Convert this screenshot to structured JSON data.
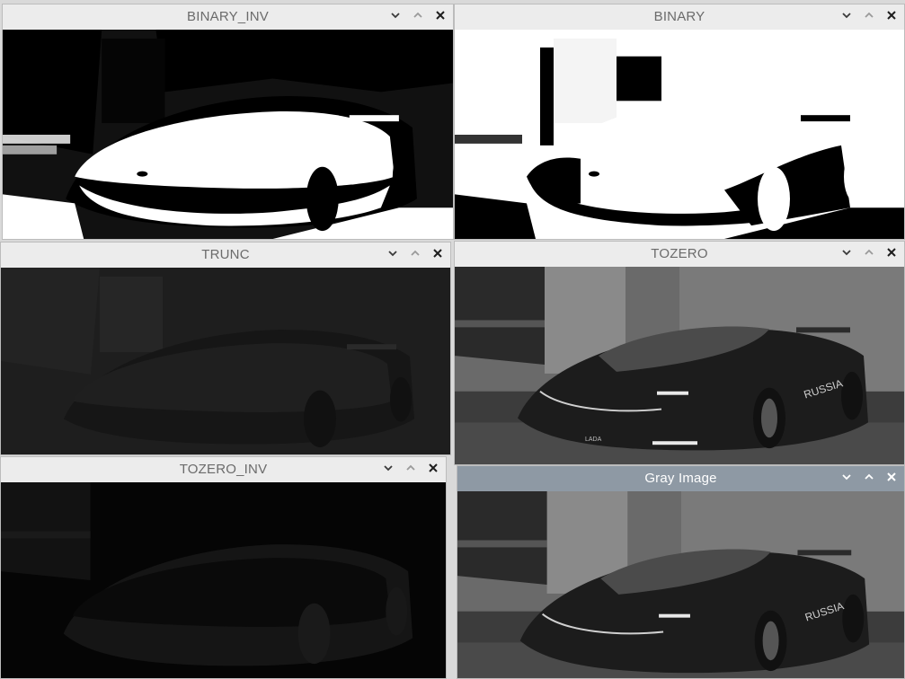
{
  "windows": [
    {
      "id": "binary_inv",
      "title": "BINARY_INV",
      "mode": "binary_inv"
    },
    {
      "id": "binary",
      "title": "BINARY",
      "mode": "binary"
    },
    {
      "id": "trunc",
      "title": "TRUNC",
      "mode": "trunc"
    },
    {
      "id": "tozero",
      "title": "TOZERO",
      "mode": "gray"
    },
    {
      "id": "tozero_inv",
      "title": "TOZERO_INV",
      "mode": "tozero_inv"
    },
    {
      "id": "gray",
      "title": "Gray Image",
      "mode": "gray",
      "active": true
    }
  ],
  "window_controls": [
    "chevron-down-icon",
    "chevron-up-icon",
    "close-icon"
  ],
  "car_decals": {
    "side": "RUSSIA",
    "plate": "LADA"
  },
  "colors": {
    "active_titlebar": "#8e99a4",
    "inactive_titlebar": "#ececec",
    "title_text": "#6b6b6b"
  }
}
